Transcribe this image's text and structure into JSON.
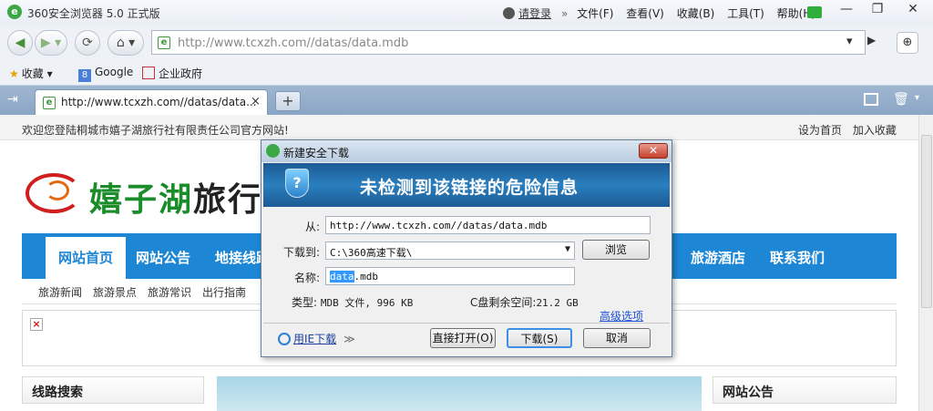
{
  "window": {
    "title": "360安全浏览器 5.0 正式版",
    "logo_char": "e",
    "login": "请登录",
    "menu_chevron": "»",
    "menus": [
      "文件(F)",
      "查看(V)",
      "收藏(B)",
      "工具(T)",
      "帮助(H)"
    ],
    "min": "—",
    "max": "❐",
    "close": "✕"
  },
  "nav": {
    "back": "◀",
    "forward": "▶ ▾",
    "refresh": "⟳",
    "home": "⌂ ▾",
    "url": "http://www.tcxzh.com//datas/data.mdb",
    "url_dropdown": "▾",
    "url_go": "▶",
    "shield": "⊕"
  },
  "bookmarks": {
    "favorites": "收藏",
    "favorites_caret": "▾",
    "google": "Google",
    "gov": "企业政府"
  },
  "tabs": {
    "side": "⇥",
    "active_label": "http://www.tcxzh.com//datas/data...",
    "close": "×",
    "new": "+",
    "trash": "🗑",
    "menu": "▾"
  },
  "page": {
    "welcome": "欢迎您登陆桐城市嬉子湖旅行社有限责任公司官方网站!",
    "set_home": "设为首页",
    "add_fav": "加入收藏",
    "logo_name": "嬉子湖",
    "logo_rest": "旅行",
    "nav_items": [
      "网站首页",
      "网站公告",
      "地接线路",
      "旅游酒店",
      "联系我们"
    ],
    "sub_items": [
      "旅游新闻",
      "旅游景点",
      "旅游常识",
      "出行指南"
    ],
    "broken_image": "×",
    "panel_search": "线路搜索",
    "panel_notice": "网站公告"
  },
  "dialog": {
    "title": "新建安全下载",
    "close": "✕",
    "shield_glyph": "?",
    "banner": "未检测到该链接的危险信息",
    "from_label": "从:",
    "from_value": "http://www.tcxzh.com//datas/data.mdb",
    "to_label": "下载到:",
    "to_value": "C:\\360高速下载\\",
    "to_arrow": "▼",
    "browse": "浏览",
    "name_label": "名称:",
    "name_selected": "data",
    "name_rest": ".mdb",
    "type_label": "类型:",
    "type_value": "MDB 文件, 996 KB",
    "free_label": "C盘剩余空间:",
    "free_value": "21.2 GB",
    "advanced": "高级选项",
    "ie_download": "用IE下载",
    "ie_more": "≫",
    "open_direct": "直接打开(O)",
    "download": "下载(S)",
    "cancel": "取消"
  }
}
